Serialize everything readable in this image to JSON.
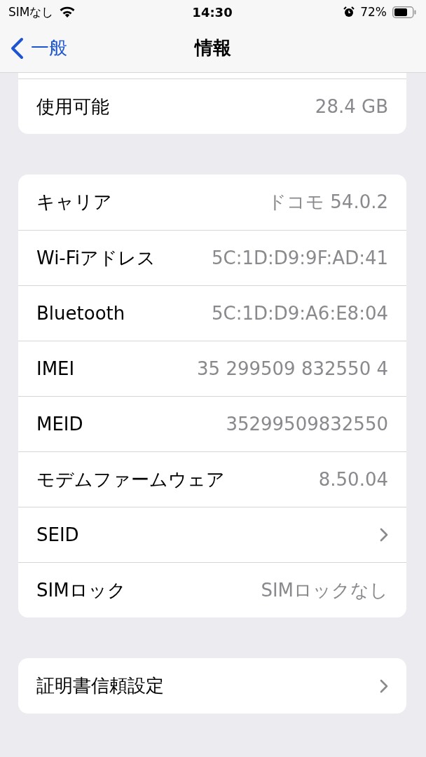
{
  "status_bar": {
    "carrier": "SIMなし",
    "time": "14:30",
    "battery_percent": "72%",
    "alarm": true
  },
  "nav": {
    "back_label": "一般",
    "title": "情報"
  },
  "groups": [
    {
      "cut_top": true,
      "rows": [
        {
          "kind": "value",
          "label": "使用可能",
          "value": "28.4 GB"
        }
      ]
    },
    {
      "cut_top": false,
      "rows": [
        {
          "kind": "value",
          "label": "キャリア",
          "value": "ドコモ 54.0.2"
        },
        {
          "kind": "value",
          "label": "Wi-Fiアドレス",
          "value": "5C:1D:D9:9F:AD:41"
        },
        {
          "kind": "value",
          "label": "Bluetooth",
          "value": "5C:1D:D9:A6:E8:04"
        },
        {
          "kind": "value",
          "label": "IMEI",
          "value": "35 299509 832550 4"
        },
        {
          "kind": "value",
          "label": "MEID",
          "value": "35299509832550"
        },
        {
          "kind": "value",
          "label": "モデムファームウェア",
          "value": "8.50.04"
        },
        {
          "kind": "link",
          "label": "SEID"
        },
        {
          "kind": "value",
          "label": "SIMロック",
          "value": "SIMロックなし"
        }
      ]
    },
    {
      "cut_top": false,
      "rows": [
        {
          "kind": "link",
          "label": "証明書信頼設定"
        }
      ]
    }
  ]
}
